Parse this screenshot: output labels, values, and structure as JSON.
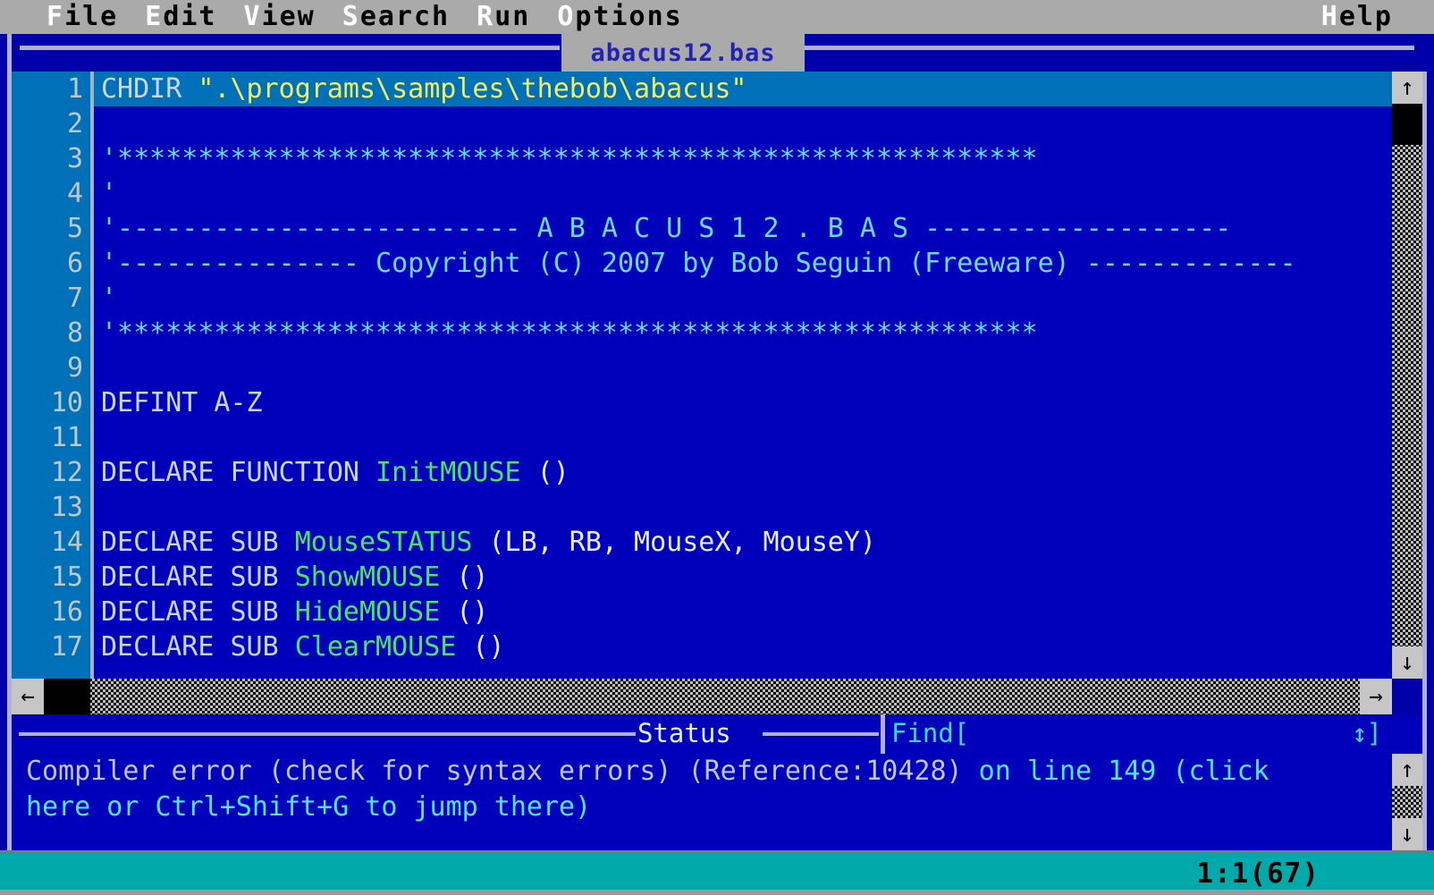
{
  "menubar": {
    "items": [
      {
        "hot": "F",
        "rest": "ile",
        "name": "menu-file"
      },
      {
        "hot": "E",
        "rest": "dit",
        "name": "menu-edit"
      },
      {
        "hot": "V",
        "rest": "iew",
        "name": "menu-view"
      },
      {
        "hot": "S",
        "rest": "earch",
        "name": "menu-search"
      },
      {
        "hot": "R",
        "rest": "un",
        "name": "menu-run"
      },
      {
        "hot": "O",
        "rest": "ptions",
        "name": "menu-options"
      }
    ],
    "help": {
      "hot": "H",
      "rest": "elp"
    }
  },
  "window": {
    "title": "abacus12.bas"
  },
  "editor": {
    "line_numbers": [
      "1",
      "2",
      "3",
      "4",
      "5",
      "6",
      "7",
      "8",
      "9",
      "10",
      "11",
      "12",
      "13",
      "14",
      "15",
      "16",
      "17"
    ],
    "current_line": 1,
    "lines": [
      {
        "n": "1",
        "current": true,
        "segments": [
          {
            "t": "CHDIR ",
            "c": "kw"
          },
          {
            "t": "\".\\programs\\samples\\thebob\\abacus\"",
            "c": "str"
          }
        ]
      },
      {
        "n": "2",
        "current": false,
        "segments": []
      },
      {
        "n": "3",
        "current": false,
        "segments": [
          {
            "t": "'*********************************************************",
            "c": "cmt"
          }
        ]
      },
      {
        "n": "4",
        "current": false,
        "segments": [
          {
            "t": "'",
            "c": "cmt"
          }
        ]
      },
      {
        "n": "5",
        "current": false,
        "segments": [
          {
            "t": "'------------------------- A B A C U S 1 2 . B A S -------------------",
            "c": "cmt"
          }
        ]
      },
      {
        "n": "6",
        "current": false,
        "segments": [
          {
            "t": "'--------------- Copyright (C) 2007 by Bob Seguin (Freeware) -------------",
            "c": "cmt"
          }
        ]
      },
      {
        "n": "7",
        "current": false,
        "segments": [
          {
            "t": "'",
            "c": "cmt"
          }
        ]
      },
      {
        "n": "8",
        "current": false,
        "segments": [
          {
            "t": "'*********************************************************",
            "c": "cmt"
          }
        ]
      },
      {
        "n": "9",
        "current": false,
        "segments": []
      },
      {
        "n": "10",
        "current": false,
        "segments": [
          {
            "t": "DEFINT A-Z",
            "c": "kw"
          }
        ]
      },
      {
        "n": "11",
        "current": false,
        "segments": []
      },
      {
        "n": "12",
        "current": false,
        "segments": [
          {
            "t": "DECLARE FUNCTION ",
            "c": "kw"
          },
          {
            "t": "InitMOUSE",
            "c": "id"
          },
          {
            "t": " ()",
            "c": "pl"
          }
        ]
      },
      {
        "n": "13",
        "current": false,
        "segments": []
      },
      {
        "n": "14",
        "current": false,
        "segments": [
          {
            "t": "DECLARE SUB ",
            "c": "kw"
          },
          {
            "t": "MouseSTATUS",
            "c": "id"
          },
          {
            "t": " (LB, RB, MouseX, MouseY)",
            "c": "pl"
          }
        ]
      },
      {
        "n": "15",
        "current": false,
        "segments": [
          {
            "t": "DECLARE SUB ",
            "c": "kw"
          },
          {
            "t": "ShowMOUSE",
            "c": "id"
          },
          {
            "t": " ()",
            "c": "pl"
          }
        ]
      },
      {
        "n": "16",
        "current": false,
        "segments": [
          {
            "t": "DECLARE SUB ",
            "c": "kw"
          },
          {
            "t": "HideMOUSE",
            "c": "id"
          },
          {
            "t": " ()",
            "c": "pl"
          }
        ]
      },
      {
        "n": "17",
        "current": false,
        "segments": [
          {
            "t": "DECLARE SUB ",
            "c": "kw"
          },
          {
            "t": "ClearMOUSE",
            "c": "id"
          },
          {
            "t": " ()",
            "c": "pl"
          }
        ]
      }
    ],
    "scroll_up_icon": "↑",
    "scroll_down_icon": "↓",
    "scroll_left_icon": "←",
    "scroll_right_icon": "→"
  },
  "status_panel": {
    "title": "Status",
    "find_label": "Find[",
    "resize_widget": "↕]",
    "message_line1": "Compiler error (check for syntax errors) (Reference:10428) ",
    "message_line1_link": "on line 149 (click",
    "message_line2": "here or Ctrl+Shift+G to jump there)",
    "scroll_up_icon": "↑",
    "scroll_down_icon": "↓"
  },
  "bottombar": {
    "cursor_position": "1:1(67)"
  },
  "colors": {
    "window_blue": "#0000AA",
    "editor_blue": "#0000BB",
    "current_line": "#0070B8",
    "menubar_gray": "#AAAAAA",
    "keyword": "#C9D6F0",
    "string": "#F0F060",
    "comment": "#66DDF5",
    "identifier": "#44E866",
    "status_teal": "#00AAAA",
    "link_cyan": "#4FE6FF"
  }
}
